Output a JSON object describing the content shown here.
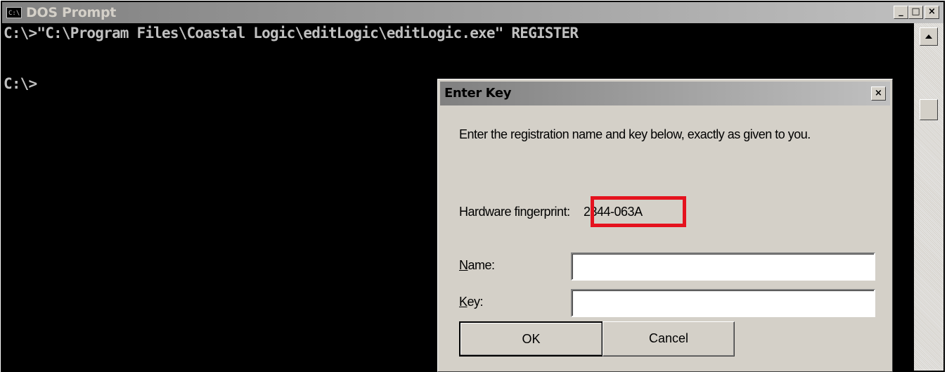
{
  "window": {
    "title": "DOS Prompt",
    "icon_text": "C:\\",
    "minimize": "_",
    "maximize": "□",
    "close": "×"
  },
  "console": {
    "lines": [
      "C:\\>\"C:\\Program Files\\Coastal Logic\\editLogic\\editLogic.exe\" REGISTER",
      "",
      "C:\\>"
    ]
  },
  "dialog": {
    "title": "Enter Key",
    "close": "×",
    "instruction": "Enter the registration name and key below, exactly as given to you.",
    "fingerprint_label": "Hardware fingerprint:",
    "fingerprint_value": "2344-063A",
    "name_label_accel": "N",
    "name_label_rest": "ame:",
    "key_label_accel": "K",
    "key_label_rest": "ey:",
    "name_value": "",
    "key_value": "",
    "ok_label": "OK",
    "cancel_label": "Cancel"
  },
  "colors": {
    "highlight": "#e5121e",
    "console_bg": "#000000",
    "console_text": "#c0c0c0",
    "dialog_bg": "#d4d0c8"
  }
}
